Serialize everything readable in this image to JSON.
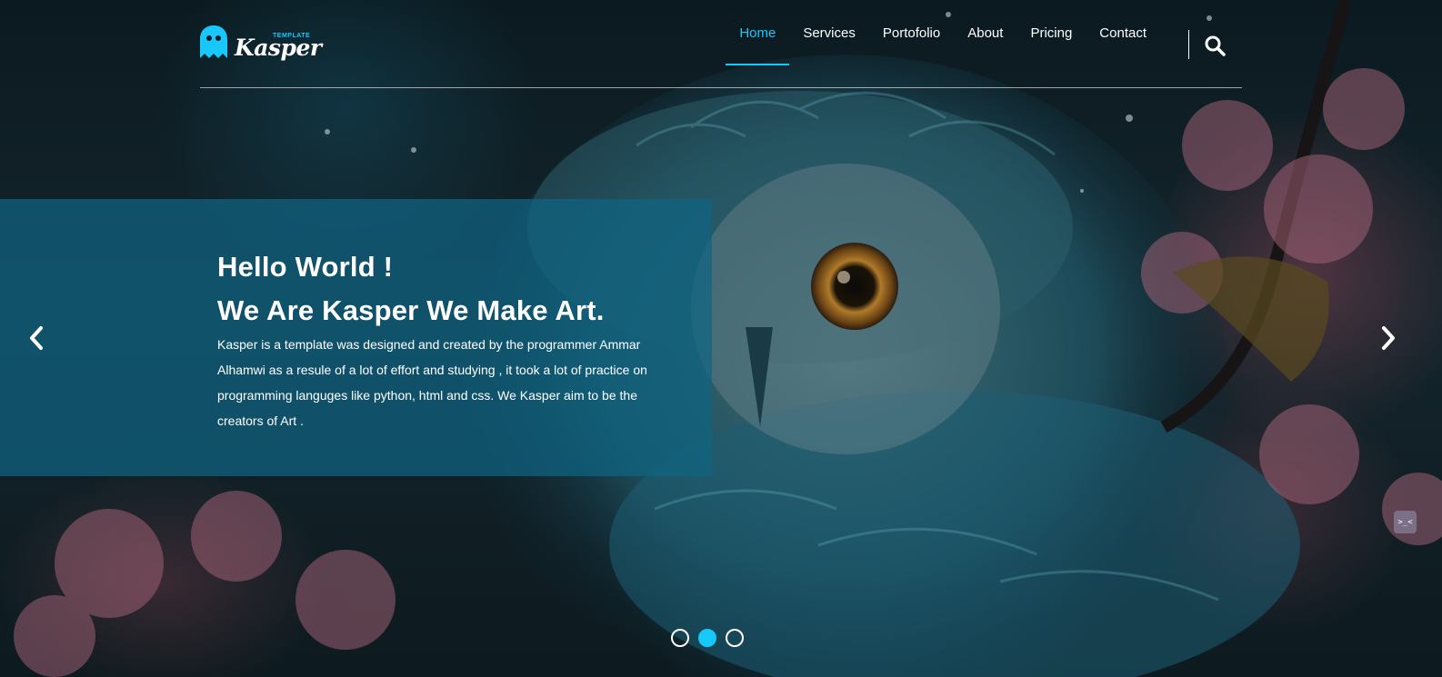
{
  "brand": {
    "small": "TEMPLATE",
    "name": "Kasper",
    "accent": "#19c8fa"
  },
  "nav": {
    "items": [
      {
        "label": "Home",
        "active": true
      },
      {
        "label": "Services"
      },
      {
        "label": "Portofolio"
      },
      {
        "label": "About"
      },
      {
        "label": "Pricing"
      },
      {
        "label": "Contact"
      }
    ],
    "search_icon": "search-icon"
  },
  "hero": {
    "title_line1": "Hello World !",
    "title_line2": "We Are Kasper We Make Art.",
    "description": "Kasper is a template was designed and created by the programmer Ammar Alhamwi as a resule of a lot of effort and studying , it took a lot of practice on programming languges like python, html and css. We Kasper aim to be the creators of Art .",
    "prev_icon": "chevron-left-icon",
    "next_icon": "chevron-right-icon",
    "slides": 3,
    "active_slide": 2
  },
  "widget": {
    "label": ">_<"
  }
}
